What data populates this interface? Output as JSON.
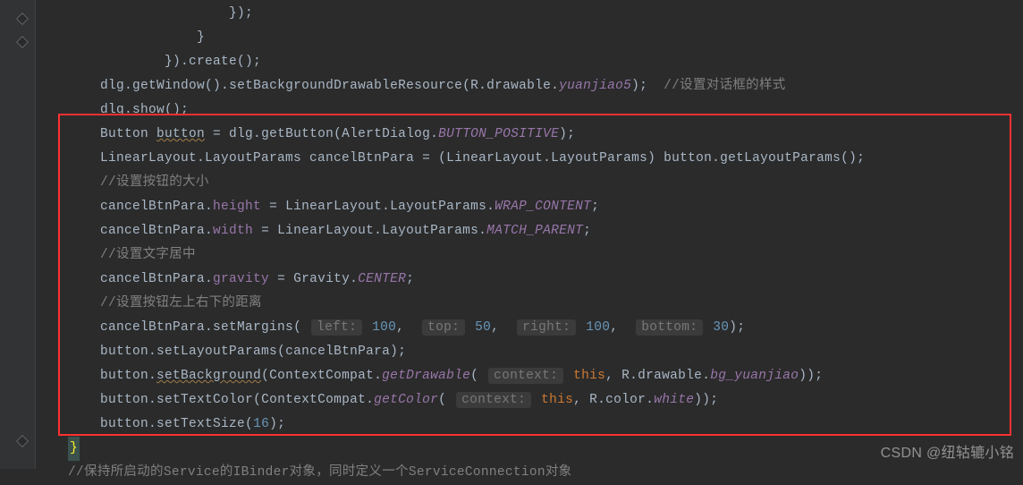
{
  "watermark": "CSDN @纽轱辘小铭",
  "lines": {
    "l1a": "                        });",
    "l1b": "                    }",
    "l2a": "                }).",
    "l2b": "create",
    "l2c": "();",
    "l3a": "dlg.",
    "l3b": "getWindow",
    "l3c": "().",
    "l3d": "setBackgroundDrawableResource",
    "l3e": "(R.drawable.",
    "l3f": "yuanjiao5",
    "l3g": ");  ",
    "l3h": "//设置对话框的样式",
    "l4a": "dlg.",
    "l4b": "show",
    "l4c": "();",
    "l5a": "Button ",
    "l5b": "button",
    "l5c": " = dlg.",
    "l5d": "getButton",
    "l5e": "(AlertDialog.",
    "l5f": "BUTTON_POSITIVE",
    "l5g": ");",
    "l6a": "LinearLayout.LayoutParams cancelBtnPara = (LinearLayout.LayoutParams) button.",
    "l6b": "getLayoutParams",
    "l6c": "();",
    "l7": "//设置按钮的大小",
    "l8a": "cancelBtnPara.",
    "l8b": "height",
    "l8c": " = LinearLayout.LayoutParams.",
    "l8d": "WRAP_CONTENT",
    "l8e": ";",
    "l9a": "cancelBtnPara.",
    "l9b": "width",
    "l9c": " = LinearLayout.LayoutParams.",
    "l9d": "MATCH_PARENT",
    "l9e": ";",
    "l10": "//设置文字居中",
    "l11a": "cancelBtnPara.",
    "l11b": "gravity",
    "l11c": " = Gravity.",
    "l11d": "CENTER",
    "l11e": ";",
    "l12": "//设置按钮左上右下的距离",
    "l13a": "cancelBtnPara.",
    "l13b": "setMargins",
    "l13c": "( ",
    "l13_h1": "left:",
    "l13_v1": " 100",
    "l13_s1": ",  ",
    "l13_h2": "top:",
    "l13_v2": " 50",
    "l13_s2": ",  ",
    "l13_h3": "right:",
    "l13_v3": " 100",
    "l13_s3": ",  ",
    "l13_h4": "bottom:",
    "l13_v4": " 30",
    "l13d": ");",
    "l14a": "button.",
    "l14b": "setLayoutParams",
    "l14c": "(cancelBtnPara);",
    "l15a": "button.",
    "l15b": "setBackground",
    "l15c": "(ContextCompat.",
    "l15d": "getDrawable",
    "l15e": "( ",
    "l15_h": "context:",
    "l15f": " ",
    "l15g": "this",
    "l15h": ", R.drawable.",
    "l15i": "bg_yuanjiao",
    "l15j": "));",
    "l16a": "button.",
    "l16b": "setTextColor",
    "l16c": "(ContextCompat.",
    "l16d": "getColor",
    "l16e": "( ",
    "l16_h": "context:",
    "l16f": " ",
    "l16g": "this",
    "l16h": ", R.color.",
    "l16i": "white",
    "l16j": "));",
    "l17a": "button.",
    "l17b": "setTextSize",
    "l17c": "(",
    "l17d": "16",
    "l17e": ");",
    "l18": "}",
    "l19": "//保持所启动的Service的IBinder对象，同时定义一个ServiceConnection对象"
  }
}
